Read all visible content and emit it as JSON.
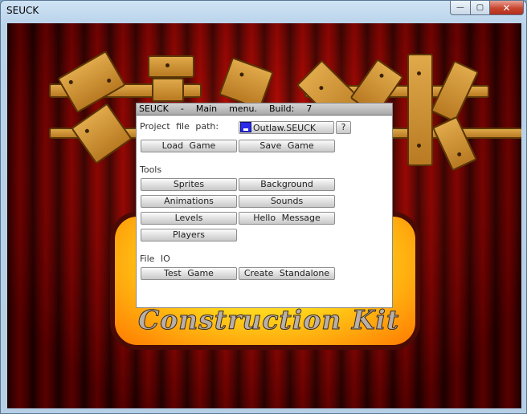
{
  "window": {
    "title": "SEUCK",
    "controls": {
      "minimize": "—",
      "maximize": "▢",
      "close": "✕"
    }
  },
  "background": {
    "logo_subtitle": "Construction Kit"
  },
  "dialog": {
    "title": "SEUCK  -  Main  menu.  Build:  7",
    "project_path_label": "Project  file  path:",
    "project_file": "Outlaw.SEUCK",
    "help_button": "?",
    "load_game": "Load  Game",
    "save_game": "Save  Game",
    "tools_label": "Tools",
    "sprites": "Sprites",
    "background": "Background",
    "animations": "Animations",
    "sounds": "Sounds",
    "levels": "Levels",
    "hello_message": "Hello  Message",
    "players": "Players",
    "file_io_label": "File  IO",
    "test_game": "Test  Game",
    "create_standalone": "Create  Standalone"
  }
}
